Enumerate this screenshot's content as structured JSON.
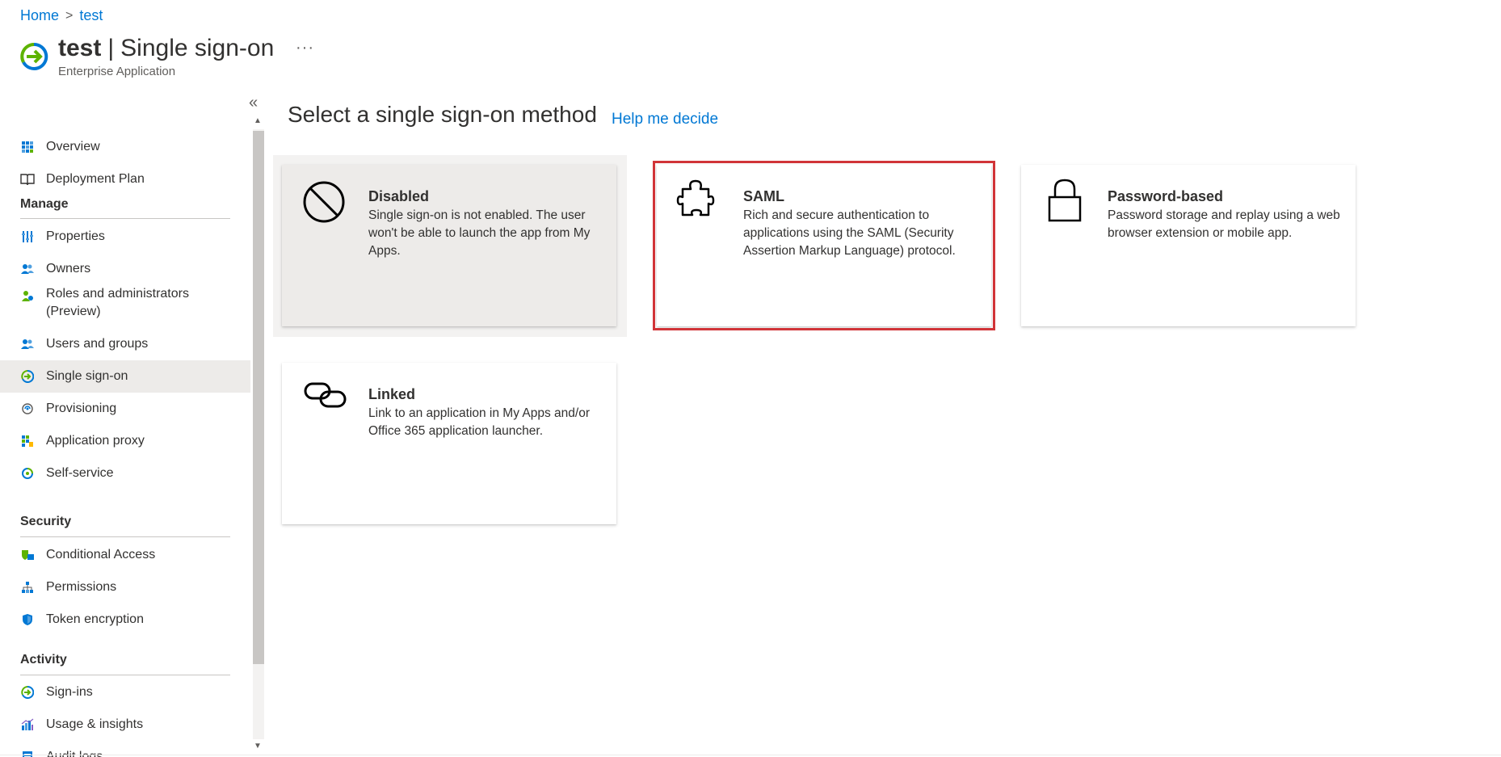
{
  "breadcrumb": {
    "home": "Home",
    "separator": ">",
    "current": "test"
  },
  "header": {
    "title_bold": "test",
    "title_pipe": "|",
    "title_rest": "Single sign-on",
    "subtitle": "Enterprise Application",
    "more": "···"
  },
  "sidebar": {
    "collapse": "«",
    "items_top": [
      {
        "label": "Overview",
        "icon": "overview-grid-icon"
      },
      {
        "label": "Deployment Plan",
        "icon": "book-icon"
      }
    ],
    "manage_label": "Manage",
    "manage_items": [
      {
        "label": "Properties",
        "icon": "properties-icon"
      },
      {
        "label": "Owners",
        "icon": "owners-icon"
      },
      {
        "label": "Roles and administrators (Preview)",
        "icon": "roles-icon"
      },
      {
        "label": "Users and groups",
        "icon": "users-groups-icon"
      },
      {
        "label": "Single sign-on",
        "icon": "sso-icon"
      },
      {
        "label": "Provisioning",
        "icon": "provisioning-icon"
      },
      {
        "label": "Application proxy",
        "icon": "app-proxy-icon"
      },
      {
        "label": "Self-service",
        "icon": "self-service-icon"
      }
    ],
    "security_label": "Security",
    "security_items": [
      {
        "label": "Conditional Access",
        "icon": "conditional-access-icon"
      },
      {
        "label": "Permissions",
        "icon": "permissions-icon"
      },
      {
        "label": "Token encryption",
        "icon": "shield-icon"
      }
    ],
    "activity_label": "Activity",
    "activity_items": [
      {
        "label": "Sign-ins",
        "icon": "sign-ins-icon"
      },
      {
        "label": "Usage & insights",
        "icon": "insights-icon"
      },
      {
        "label": "Audit logs",
        "icon": "audit-icon"
      }
    ]
  },
  "main": {
    "heading": "Select a single sign-on method",
    "help_link": "Help me decide",
    "cards": [
      {
        "title": "Disabled",
        "description": "Single sign-on is not enabled. The user won't be able to launch the app from My Apps.",
        "icon": "disabled-circle-icon"
      },
      {
        "title": "SAML",
        "description": "Rich and secure authentication to applications using the SAML (Security Assertion Markup Language) protocol.",
        "icon": "puzzle-icon"
      },
      {
        "title": "Password-based",
        "description": "Password storage and replay using a web browser extension or mobile app.",
        "icon": "lock-icon"
      },
      {
        "title": "Linked",
        "description": "Link to an application in My Apps and/or Office 365 application launcher.",
        "icon": "link-icon"
      }
    ]
  },
  "colors": {
    "accent": "#0078d4",
    "highlight_border": "#d13438",
    "active_nav": "#edebe9"
  }
}
